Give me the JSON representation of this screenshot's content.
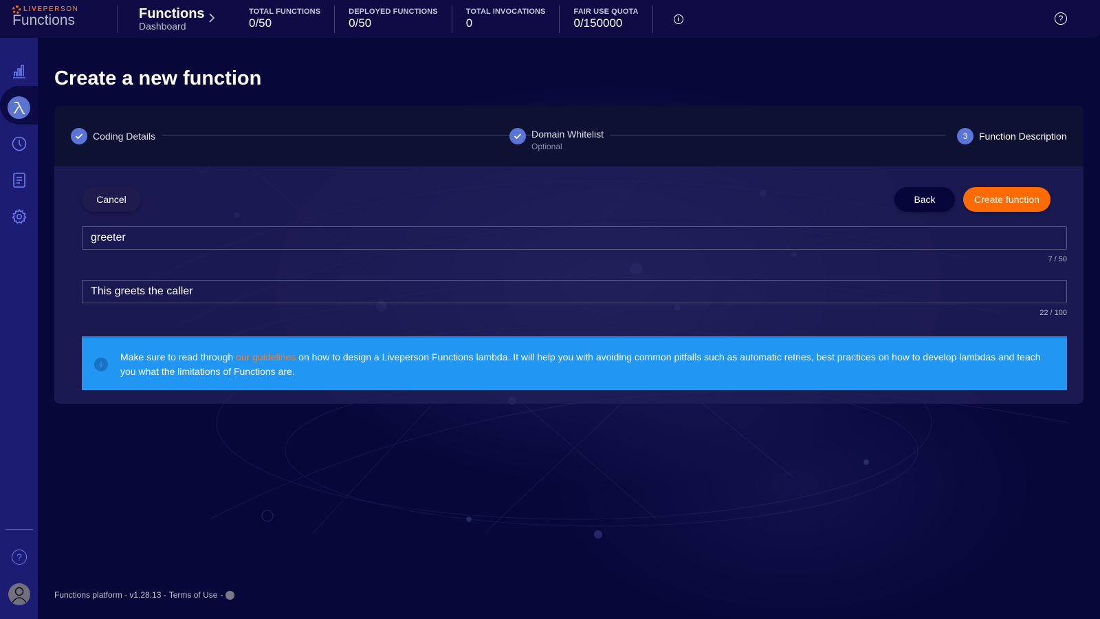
{
  "header": {
    "logo_brand": "LIVE",
    "logo_brand2": "PERSON",
    "logo_product": "Functions",
    "app_title": "Functions",
    "app_subtitle": "Dashboard",
    "stats": [
      {
        "label": "TOTAL FUNCTIONS",
        "value": "0/50"
      },
      {
        "label": "DEPLOYED FUNCTIONS",
        "value": "0/50"
      },
      {
        "label": "TOTAL INVOCATIONS",
        "value": "0"
      },
      {
        "label": "FAIR USE QUOTA",
        "value": "0/150000"
      }
    ],
    "info_icon": "i",
    "help_icon": "?"
  },
  "sidebar": {
    "items": [
      {
        "name": "dashboard",
        "icon": "bar-chart-icon"
      },
      {
        "name": "functions",
        "icon": "lambda-icon",
        "active": true
      },
      {
        "name": "history",
        "icon": "clock-icon"
      },
      {
        "name": "logs",
        "icon": "document-icon"
      },
      {
        "name": "settings",
        "icon": "gear-icon"
      }
    ],
    "help_icon": "?"
  },
  "page": {
    "title": "Create a new function"
  },
  "stepper": {
    "steps": [
      {
        "label": "Coding Details",
        "state": "completed",
        "sublabel": ""
      },
      {
        "label": "Domain Whitelist",
        "state": "completed",
        "sublabel": "Optional"
      },
      {
        "label": "Function Description",
        "state": "active",
        "number": "3",
        "sublabel": ""
      }
    ]
  },
  "form": {
    "cancel_label": "Cancel",
    "back_label": "Back",
    "create_label": "Create function",
    "name_value": "greeter",
    "name_counter": "7 / 50",
    "description_value": "This greets the caller",
    "description_counter": "22 / 100"
  },
  "banner": {
    "text_before": "Make sure to read through ",
    "link_text": "our guidelines",
    "text_after": " on how to design a Liveperson Functions lambda. It will help you with avoiding common pitfalls such as automatic retries, best practices on how to develop lambdas and teach you what the limitations of Functions are."
  },
  "footer": {
    "platform": "Functions platform - v1.28.13 - ",
    "terms": "Terms of Use",
    "sep": " - "
  },
  "colors": {
    "accent_orange": "#ff6b00",
    "step_blue": "#5b75d6",
    "banner_blue": "#2196f3",
    "background": "#07073a",
    "sidebar": "#1c1c72"
  }
}
